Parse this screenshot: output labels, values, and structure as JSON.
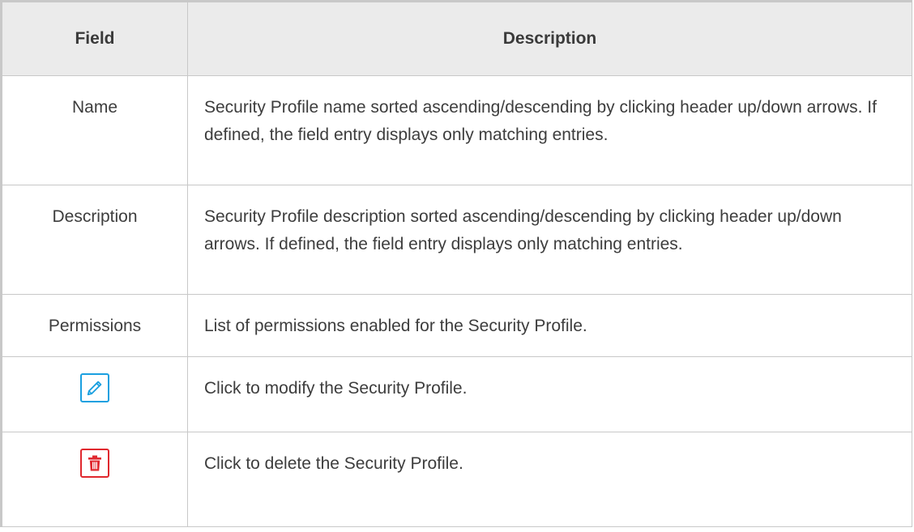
{
  "table": {
    "headers": {
      "field": "Field",
      "description": "Description"
    },
    "rows": [
      {
        "field": "Name",
        "description": "Security Profile name sorted ascending/descending by clicking header up/down arrows. If defined, the field entry displays only matching entries."
      },
      {
        "field": "Description",
        "description": "Security Profile description sorted ascending/descending by clicking header up/down arrows. If defined, the field entry displays only matching entries."
      },
      {
        "field": "Permissions",
        "description": "List of permissions enabled for the Security Profile."
      },
      {
        "field_icon": "pencil-icon",
        "description": "Click to modify the Security Profile."
      },
      {
        "field_icon": "trash-icon",
        "description": "Click to delete the Security Profile."
      }
    ]
  },
  "colors": {
    "edit_icon": "#1aa0e0",
    "delete_icon": "#e0282e",
    "header_bg": "#ebebeb",
    "border": "#c8c8c8"
  }
}
